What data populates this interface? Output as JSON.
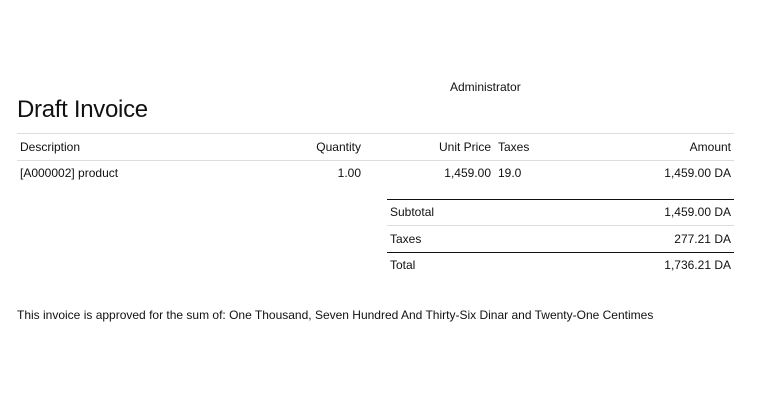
{
  "header": {
    "user": "Administrator",
    "title": "Draft Invoice"
  },
  "table": {
    "columns": {
      "description": "Description",
      "quantity": "Quantity",
      "unit_price": "Unit Price",
      "taxes": "Taxes",
      "amount": "Amount"
    },
    "rows": [
      {
        "description": "[A000002] product",
        "quantity": "1.00",
        "unit_price": "1,459.00",
        "taxes": "19.0",
        "amount": "1,459.00 DA"
      }
    ]
  },
  "totals": {
    "subtotal_label": "Subtotal",
    "subtotal": "1,459.00 DA",
    "taxes_label": "Taxes",
    "taxes": "277.21 DA",
    "total_label": "Total",
    "total": "1,736.21 DA"
  },
  "amount_in_words": "This invoice is approved for the sum of: One Thousand, Seven Hundred And Thirty-Six Dinar and Twenty-One Centimes"
}
